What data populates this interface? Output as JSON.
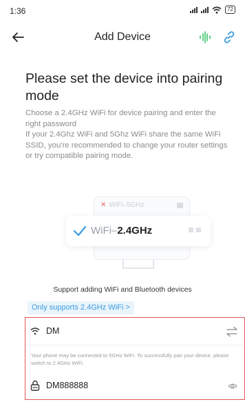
{
  "status_bar": {
    "time": "1:36",
    "battery": "72"
  },
  "nav": {
    "title": "Add Device"
  },
  "main": {
    "heading": "Please set the device into pairing mode",
    "desc_line1": "Choose a 2.4GHz WiFi for device pairing and enter the right password",
    "desc_line2": "If your 2.4Ghz WiFi and 5Ghz WiFi share the same WiFi SSID, you're recommended to change your router settings or try compatible pairing mode."
  },
  "illustration": {
    "wifi_5g": "WiFi–5GHz",
    "wifi_prefix": "WiFi–",
    "wifi_band": "2.4GHz"
  },
  "support_text": "Support adding WiFi and Bluetooth devices",
  "only_24_label": "Only supports 2.4GHz WiFi >",
  "form": {
    "ssid": "DM",
    "hint": "Your phone may be connected to 5GHz WiFi. To successfully pair your device, please switch to 2.4GHz WiFi.",
    "password": "DM888888"
  },
  "colors": {
    "accent_blue": "#3a9ae0",
    "voice_green": "#3cc46a",
    "highlight_red": "#e25555"
  },
  "icons": [
    "back-icon",
    "voice-icon",
    "link-icon",
    "check-icon",
    "wifi-icon",
    "switch-icon",
    "lock-icon",
    "eye-icon"
  ]
}
